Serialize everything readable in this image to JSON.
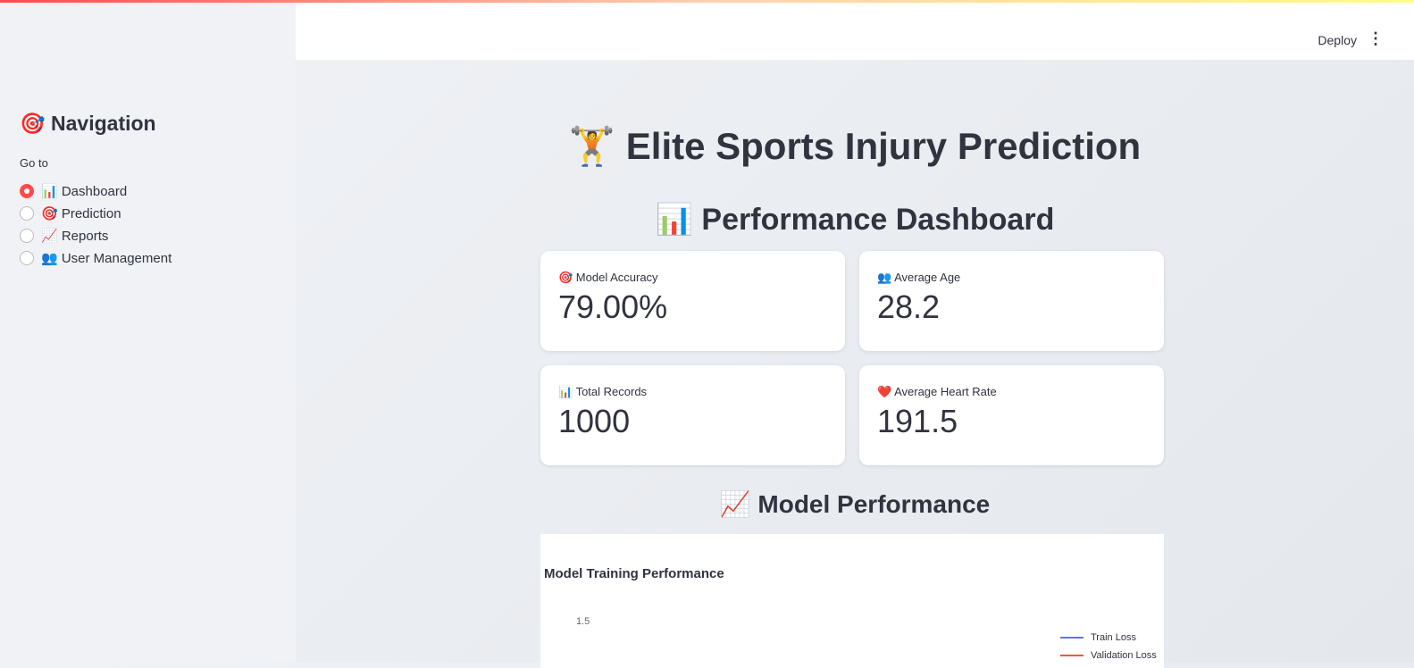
{
  "header": {
    "deploy_label": "Deploy",
    "menu_icon": "vertical-dots-icon"
  },
  "sidebar": {
    "title": "🎯 Navigation",
    "goto_label": "Go to",
    "items": [
      {
        "label": "📊 Dashboard",
        "selected": true
      },
      {
        "label": "🎯 Prediction",
        "selected": false
      },
      {
        "label": "📈 Reports",
        "selected": false
      },
      {
        "label": "👥 User Management",
        "selected": false
      }
    ]
  },
  "main": {
    "title": "🏋️ Elite Sports Injury Prediction",
    "dashboard_title": "📊 Performance Dashboard",
    "metrics": [
      {
        "label": "🎯 Model Accuracy",
        "value": "79.00%"
      },
      {
        "label": "👥 Average Age",
        "value": "28.2"
      },
      {
        "label": "📊 Total Records",
        "value": "1000"
      },
      {
        "label": "❤️ Average Heart Rate",
        "value": "191.5"
      }
    ],
    "model_title": "📈 Model Performance"
  },
  "accent": "#ff4b4b",
  "chart_data": {
    "type": "line",
    "title": "Model Training Performance",
    "yticks": [
      "1.5"
    ],
    "legend_placement": "right",
    "series": [
      {
        "name": "Train Loss",
        "color": "#636efa"
      },
      {
        "name": "Validation Loss",
        "color": "#ef553b"
      }
    ]
  }
}
